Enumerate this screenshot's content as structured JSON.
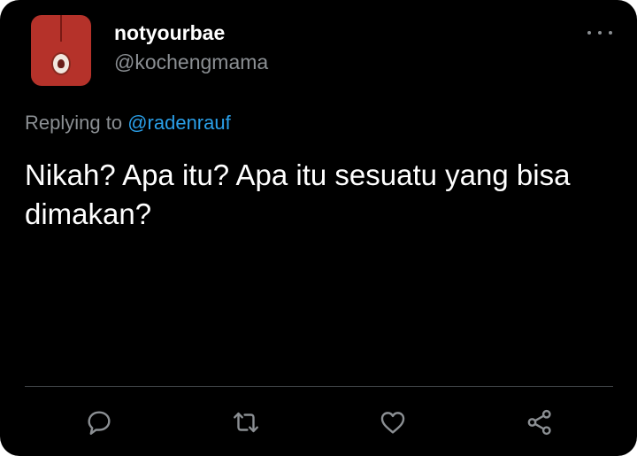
{
  "tweet": {
    "display_name": "notyourbae",
    "handle": "@kochengmama",
    "replying_prefix": "Replying to",
    "replying_to": "@radenrauf",
    "text": "Nikah? Apa itu? Apa itu sesuatu yang bisa dimakan?"
  },
  "icons": {
    "more": "more-horizontal-icon",
    "reply": "reply-bubble-icon",
    "retweet": "retweet-icon",
    "like": "heart-icon",
    "share": "share-icon"
  },
  "colors": {
    "background": "#000000",
    "primary_text": "#ffffff",
    "secondary_text": "#8b8f93",
    "link": "#2a9fe8",
    "avatar_bg": "#b5322a"
  }
}
